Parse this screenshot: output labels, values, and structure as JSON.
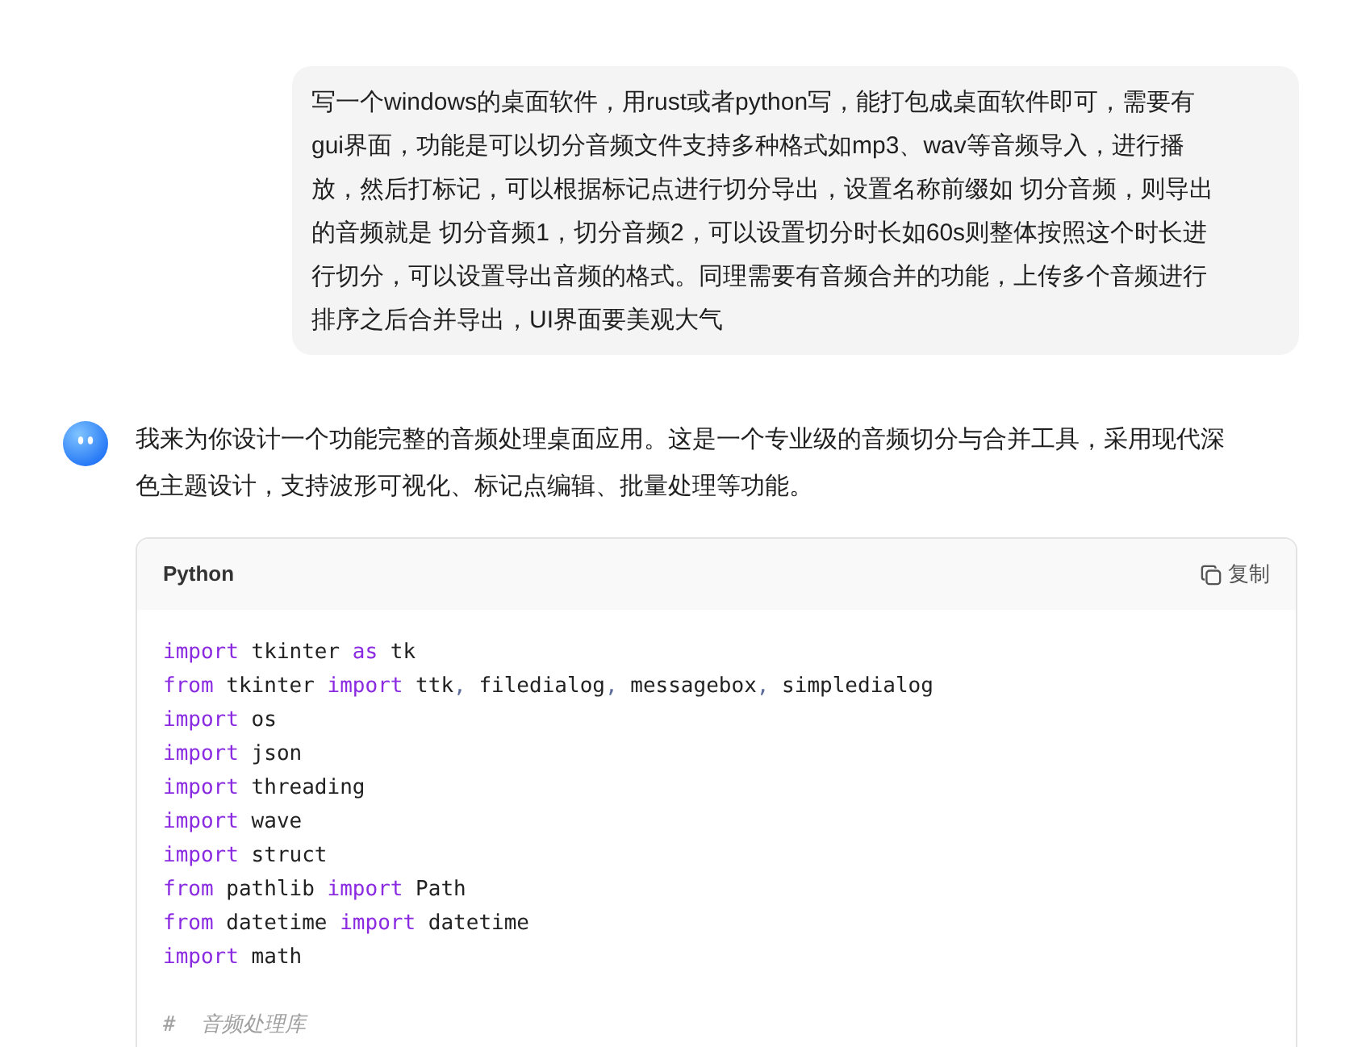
{
  "user_message": {
    "text": "写一个windows的桌面软件，用rust或者python写，能打包成桌面软件即可，需要有gui界面，功能是可以切分音频文件支持多种格式如mp3、wav等音频导入，进行播放，然后打标记，可以根据标记点进行切分导出，设置名称前缀如 切分音频，则导出的音频就是 切分音频1，切分音频2，可以设置切分时长如60s则整体按照这个时长进行切分，可以设置导出音频的格式。同理需要有音频合并的功能，上传多个音频进行排序之后合并导出，UI界面要美观大气"
  },
  "assistant_message": {
    "text": "我来为你设计一个功能完整的音频处理桌面应用。这是一个专业级的音频切分与合并工具，采用现代深色主题设计，支持波形可视化、标记点编辑、批量处理等功能。",
    "code_block": {
      "language": "Python",
      "copy_label": "复制",
      "lines": [
        [
          {
            "kind": "keyword",
            "text": "import"
          },
          {
            "kind": "name",
            "text": " tkinter "
          },
          {
            "kind": "keyword",
            "text": "as"
          },
          {
            "kind": "name",
            "text": " tk"
          }
        ],
        [
          {
            "kind": "keyword",
            "text": "from"
          },
          {
            "kind": "name",
            "text": " tkinter "
          },
          {
            "kind": "keyword",
            "text": "import"
          },
          {
            "kind": "name",
            "text": " ttk"
          },
          {
            "kind": "punct",
            "text": ","
          },
          {
            "kind": "name",
            "text": " filedialog"
          },
          {
            "kind": "punct",
            "text": ","
          },
          {
            "kind": "name",
            "text": " messagebox"
          },
          {
            "kind": "punct",
            "text": ","
          },
          {
            "kind": "name",
            "text": " simpledialog"
          }
        ],
        [
          {
            "kind": "keyword",
            "text": "import"
          },
          {
            "kind": "name",
            "text": " os"
          }
        ],
        [
          {
            "kind": "keyword",
            "text": "import"
          },
          {
            "kind": "name",
            "text": " json"
          }
        ],
        [
          {
            "kind": "keyword",
            "text": "import"
          },
          {
            "kind": "name",
            "text": " threading"
          }
        ],
        [
          {
            "kind": "keyword",
            "text": "import"
          },
          {
            "kind": "name",
            "text": " wave"
          }
        ],
        [
          {
            "kind": "keyword",
            "text": "import"
          },
          {
            "kind": "name",
            "text": " struct"
          }
        ],
        [
          {
            "kind": "keyword",
            "text": "from"
          },
          {
            "kind": "name",
            "text": " pathlib "
          },
          {
            "kind": "keyword",
            "text": "import"
          },
          {
            "kind": "name",
            "text": " Path"
          }
        ],
        [
          {
            "kind": "keyword",
            "text": "from"
          },
          {
            "kind": "name",
            "text": " datetime "
          },
          {
            "kind": "keyword",
            "text": "import"
          },
          {
            "kind": "name",
            "text": " datetime"
          }
        ],
        [
          {
            "kind": "keyword",
            "text": "import"
          },
          {
            "kind": "name",
            "text": " math"
          }
        ],
        {
          "kind": "blank"
        },
        [
          {
            "kind": "comment",
            "text": "#  音频处理库"
          }
        ]
      ]
    }
  }
}
